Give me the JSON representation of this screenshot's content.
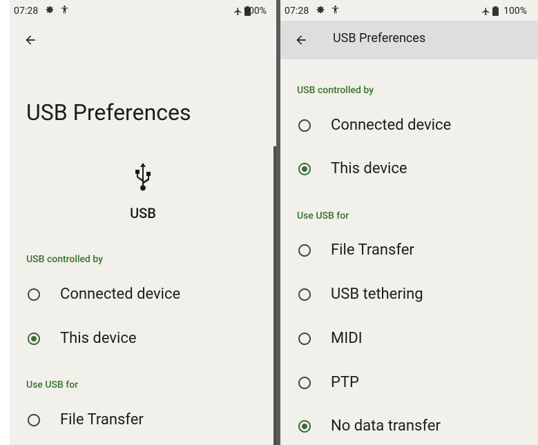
{
  "status": {
    "time": "07:28",
    "battery": "100%",
    "icons": [
      "settings-gear-icon",
      "accessibility-icon",
      "airplane-icon",
      "battery-icon"
    ]
  },
  "left": {
    "title": "USB Preferences",
    "usb_label": "USB",
    "section_controlled": "USB controlled by",
    "controlled_options": [
      {
        "label": "Connected device",
        "checked": false
      },
      {
        "label": "This device",
        "checked": true
      }
    ],
    "section_use": "Use USB for",
    "use_options": [
      {
        "label": "File Transfer",
        "checked": false
      }
    ]
  },
  "right": {
    "appbar_title": "USB Preferences",
    "section_controlled": "USB controlled by",
    "controlled_options": [
      {
        "label": "Connected device",
        "checked": false
      },
      {
        "label": "This device",
        "checked": true
      }
    ],
    "section_use": "Use USB for",
    "use_options": [
      {
        "label": "File Transfer",
        "checked": false
      },
      {
        "label": "USB tethering",
        "checked": false
      },
      {
        "label": "MIDI",
        "checked": false
      },
      {
        "label": "PTP",
        "checked": false
      },
      {
        "label": "No data transfer",
        "checked": true
      }
    ]
  },
  "colors": {
    "accent": "#376b3a",
    "section_label": "#39722f",
    "background": "#f1f0ea",
    "appbar": "#dedede"
  }
}
